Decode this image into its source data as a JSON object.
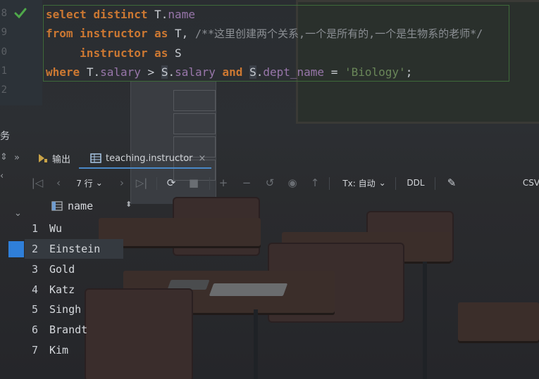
{
  "editor": {
    "line_numbers": [
      "8",
      "9",
      "0",
      "1",
      "2"
    ],
    "lines": {
      "l1": {
        "kw1": "select",
        "kw2": "distinct",
        "alias": "T",
        "dot": ".",
        "field": "name"
      },
      "l2": {
        "kw1": "from",
        "table": "instructor",
        "kw2": "as",
        "alias": "T,",
        "comment": "/**这里创建两个关系,一个是所有的,一个是生物系的老师*/"
      },
      "l3": {
        "table": "instructor",
        "kw": "as",
        "alias": "S"
      },
      "l4": {
        "kw1": "where",
        "a1": "T",
        "dot1": ".",
        "f1": "salary",
        "op": ">",
        "a2": "S",
        "dot2": ".",
        "f2": "salary",
        "kw2": "and",
        "a3": "S",
        "dot3": ".",
        "f3": "dept_name",
        "eq": "=",
        "val": "'Biology'",
        "semi": ";"
      }
    }
  },
  "services_label": "务",
  "tabs": [
    {
      "label": "输出",
      "icon": "output-icon"
    },
    {
      "label": "teaching.instructor",
      "icon": "table-icon",
      "close": "×"
    }
  ],
  "toolbar": {
    "rows_label": "7 行",
    "tx_label": "Tx: 自动",
    "ddl_label": "DDL",
    "csv_label": "CSV"
  },
  "grid": {
    "column": "name",
    "sort_glyph": "⬍",
    "rows": [
      {
        "n": "1",
        "v": "Wu"
      },
      {
        "n": "2",
        "v": "Einstein"
      },
      {
        "n": "3",
        "v": "Gold"
      },
      {
        "n": "4",
        "v": "Katz"
      },
      {
        "n": "5",
        "v": "Singh"
      },
      {
        "n": "6",
        "v": "Brandt"
      },
      {
        "n": "7",
        "v": "Kim"
      }
    ]
  },
  "colors": {
    "keyword": "#cc7832",
    "field": "#9876aa",
    "string": "#6a8759",
    "accent": "#2f7fd9"
  }
}
